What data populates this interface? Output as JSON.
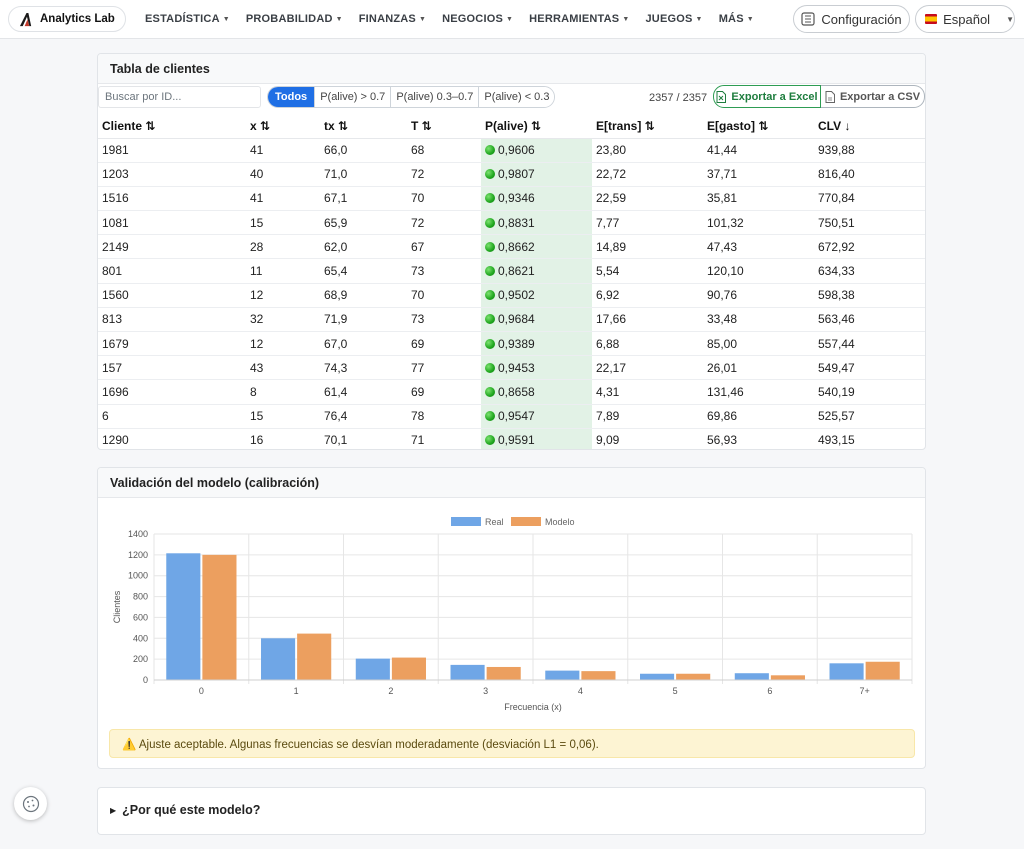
{
  "nav": {
    "brand": "Analytics Lab",
    "menu": [
      "ESTADÍSTICA",
      "PROBABILIDAD",
      "FINANZAS",
      "NEGOCIOS",
      "HERRAMIENTAS",
      "JUEGOS",
      "MÁS"
    ],
    "config_label": "Configuración",
    "lang_label": "Español"
  },
  "table_card": {
    "title": "Tabla de clientes",
    "search_placeholder": "Buscar por ID...",
    "filters": [
      "Todos",
      "P(alive) > 0.7",
      "P(alive) 0.3–0.7",
      "P(alive) < 0.3"
    ],
    "active_filter": "Todos",
    "count": "2357 / 2357",
    "export_excel": "Exportar a Excel",
    "export_csv": "Exportar a CSV",
    "columns": [
      "Cliente ⇅",
      "x ⇅",
      "tx ⇅",
      "T ⇅",
      "P(alive) ⇅",
      "E[trans] ⇅",
      "E[gasto] ⇅",
      "CLV ↓"
    ],
    "rows": [
      [
        "1981",
        "41",
        "66,0",
        "68",
        "0,9606",
        "23,80",
        "41,44",
        "939,88"
      ],
      [
        "1203",
        "40",
        "71,0",
        "72",
        "0,9807",
        "22,72",
        "37,71",
        "816,40"
      ],
      [
        "1516",
        "41",
        "67,1",
        "70",
        "0,9346",
        "22,59",
        "35,81",
        "770,84"
      ],
      [
        "1081",
        "15",
        "65,9",
        "72",
        "0,8831",
        "7,77",
        "101,32",
        "750,51"
      ],
      [
        "2149",
        "28",
        "62,0",
        "67",
        "0,8662",
        "14,89",
        "47,43",
        "672,92"
      ],
      [
        "801",
        "11",
        "65,4",
        "73",
        "0,8621",
        "5,54",
        "120,10",
        "634,33"
      ],
      [
        "1560",
        "12",
        "68,9",
        "70",
        "0,9502",
        "6,92",
        "90,76",
        "598,38"
      ],
      [
        "813",
        "32",
        "71,9",
        "73",
        "0,9684",
        "17,66",
        "33,48",
        "563,46"
      ],
      [
        "1679",
        "12",
        "67,0",
        "69",
        "0,9389",
        "6,88",
        "85,00",
        "557,44"
      ],
      [
        "157",
        "43",
        "74,3",
        "77",
        "0,9453",
        "22,17",
        "26,01",
        "549,47"
      ],
      [
        "1696",
        "8",
        "61,4",
        "69",
        "0,8658",
        "4,31",
        "131,46",
        "540,19"
      ],
      [
        "6",
        "15",
        "76,4",
        "78",
        "0,9547",
        "7,89",
        "69,86",
        "525,57"
      ],
      [
        "1290",
        "16",
        "70,1",
        "71",
        "0,9591",
        "9,09",
        "56,93",
        "493,15"
      ]
    ]
  },
  "validation_card": {
    "title": "Validación del modelo (calibración)",
    "alert": "⚠️ Ajuste aceptable. Algunas frecuencias se desvían moderadamente (desviación L1 = 0,06)."
  },
  "chart_data": {
    "type": "bar",
    "title": "",
    "xlabel": "Frecuencia (x)",
    "ylabel": "Clientes",
    "ylim": [
      0,
      1400
    ],
    "yticks": [
      0,
      200,
      400,
      600,
      800,
      1000,
      1200,
      1400
    ],
    "categories": [
      "0",
      "1",
      "2",
      "3",
      "4",
      "5",
      "6",
      "7+"
    ],
    "legend_position": "top",
    "grid": true,
    "series": [
      {
        "name": "Real",
        "color": "#6fa6e6",
        "values": [
          1215,
          400,
          205,
          145,
          90,
          60,
          65,
          160
        ]
      },
      {
        "name": "Modelo",
        "color": "#ec9f5f",
        "values": [
          1200,
          445,
          215,
          125,
          85,
          60,
          45,
          175
        ]
      }
    ]
  },
  "why_card": {
    "title": "¿Por qué este modelo?"
  }
}
